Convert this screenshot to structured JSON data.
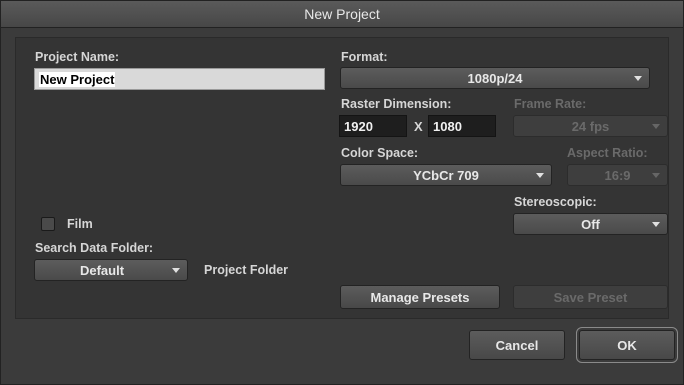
{
  "window": {
    "title": "New Project"
  },
  "project_name": {
    "label": "Project Name:",
    "value": "New Project"
  },
  "film": {
    "label": "Film",
    "checked": false
  },
  "search_data_folder": {
    "label": "Search Data Folder:",
    "value": "Default",
    "folder_label": "Project Folder"
  },
  "format": {
    "label": "Format:",
    "value": "1080p/24"
  },
  "raster_dimension": {
    "label": "Raster Dimension:",
    "width": "1920",
    "separator": "X",
    "height": "1080"
  },
  "frame_rate": {
    "label": "Frame Rate:",
    "value": "24 fps",
    "enabled": false
  },
  "color_space": {
    "label": "Color Space:",
    "value": "YCbCr 709"
  },
  "aspect_ratio": {
    "label": "Aspect Ratio:",
    "value": "16:9",
    "enabled": false
  },
  "stereoscopic": {
    "label": "Stereoscopic:",
    "value": "Off"
  },
  "buttons": {
    "manage_presets": "Manage Presets",
    "save_preset": "Save Preset",
    "cancel": "Cancel",
    "ok": "OK"
  }
}
